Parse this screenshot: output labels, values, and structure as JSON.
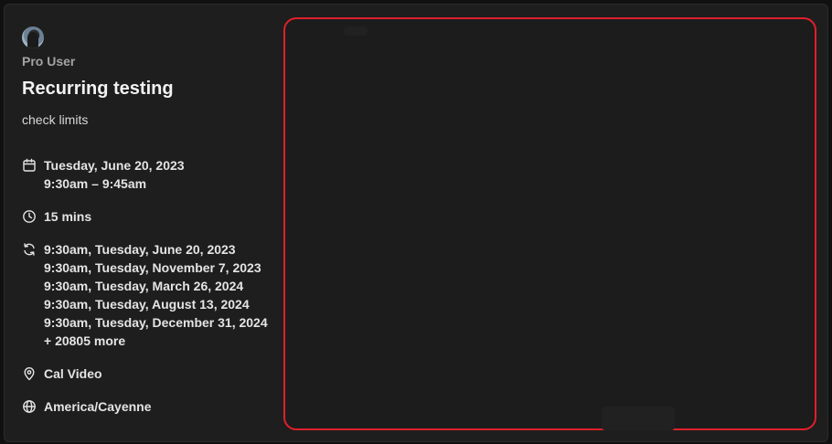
{
  "profile": {
    "name": "Pro User"
  },
  "event": {
    "title": "Recurring testing",
    "description": "check limits",
    "date": "Tuesday, June 20, 2023",
    "time_range": "9:30am – 9:45am",
    "duration": "15 mins",
    "occurrences": [
      "9:30am, Tuesday, June 20, 2023",
      "9:30am, Tuesday, November 7, 2023",
      "9:30am, Tuesday, March 26, 2024",
      "9:30am, Tuesday, August 13, 2024",
      "9:30am, Tuesday, December 31, 2024"
    ],
    "more_occurrences": "+ 20805 more",
    "location": "Cal Video",
    "timezone": "America/Cayenne"
  },
  "icons": {
    "calendar": "calendar-icon",
    "clock": "clock-icon",
    "recurring": "refresh-icon",
    "location": "map-pin-icon",
    "timezone": "globe-icon"
  },
  "colors": {
    "background": "#1e1e1e",
    "highlight_border": "#e0202a",
    "text_primary": "#f2f2f2",
    "text_muted": "#a3a3a3"
  }
}
